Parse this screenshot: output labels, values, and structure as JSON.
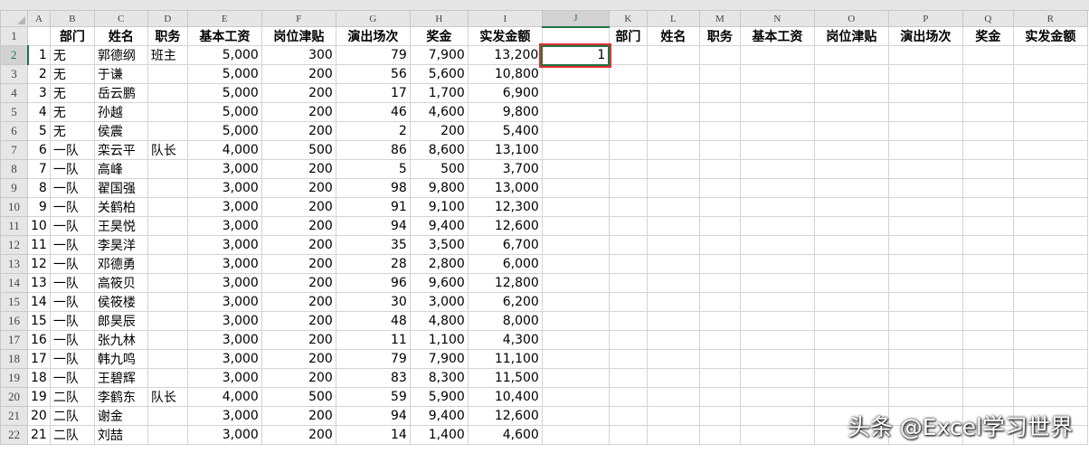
{
  "columns": [
    "A",
    "B",
    "C",
    "D",
    "E",
    "F",
    "G",
    "H",
    "I",
    "J",
    "K",
    "L",
    "M",
    "N",
    "O",
    "P",
    "Q",
    "R"
  ],
  "header_left": [
    "",
    "部门",
    "姓名",
    "职务",
    "基本工资",
    "岗位津贴",
    "演出场次",
    "奖金",
    "实发金额"
  ],
  "header_right": [
    "部门",
    "姓名",
    "职务",
    "基本工资",
    "岗位津贴",
    "演出场次",
    "奖金",
    "实发金额"
  ],
  "rows": [
    [
      "1",
      "无",
      "郭德纲",
      "班主",
      "5,000",
      "300",
      "79",
      "7,900",
      "13,200"
    ],
    [
      "2",
      "无",
      "于谦",
      "",
      "5,000",
      "200",
      "56",
      "5,600",
      "10,800"
    ],
    [
      "3",
      "无",
      "岳云鹏",
      "",
      "5,000",
      "200",
      "17",
      "1,700",
      "6,900"
    ],
    [
      "4",
      "无",
      "孙越",
      "",
      "5,000",
      "200",
      "46",
      "4,600",
      "9,800"
    ],
    [
      "5",
      "无",
      "侯震",
      "",
      "5,000",
      "200",
      "2",
      "200",
      "5,400"
    ],
    [
      "6",
      "一队",
      "栾云平",
      "队长",
      "4,000",
      "500",
      "86",
      "8,600",
      "13,100"
    ],
    [
      "7",
      "一队",
      "高峰",
      "",
      "3,000",
      "200",
      "5",
      "500",
      "3,700"
    ],
    [
      "8",
      "一队",
      "翟国强",
      "",
      "3,000",
      "200",
      "98",
      "9,800",
      "13,000"
    ],
    [
      "9",
      "一队",
      "关鹤柏",
      "",
      "3,000",
      "200",
      "91",
      "9,100",
      "12,300"
    ],
    [
      "10",
      "一队",
      "王昊悦",
      "",
      "3,000",
      "200",
      "94",
      "9,400",
      "12,600"
    ],
    [
      "11",
      "一队",
      "李昊洋",
      "",
      "3,000",
      "200",
      "35",
      "3,500",
      "6,700"
    ],
    [
      "12",
      "一队",
      "邓德勇",
      "",
      "3,000",
      "200",
      "28",
      "2,800",
      "6,000"
    ],
    [
      "13",
      "一队",
      "高筱贝",
      "",
      "3,000",
      "200",
      "96",
      "9,600",
      "12,800"
    ],
    [
      "14",
      "一队",
      "侯筱楼",
      "",
      "3,000",
      "200",
      "30",
      "3,000",
      "6,200"
    ],
    [
      "15",
      "一队",
      "郎昊辰",
      "",
      "3,000",
      "200",
      "48",
      "4,800",
      "8,000"
    ],
    [
      "16",
      "一队",
      "张九林",
      "",
      "3,000",
      "200",
      "11",
      "1,100",
      "4,300"
    ],
    [
      "17",
      "一队",
      "韩九鸣",
      "",
      "3,000",
      "200",
      "79",
      "7,900",
      "11,100"
    ],
    [
      "18",
      "一队",
      "王碧辉",
      "",
      "3,000",
      "200",
      "83",
      "8,300",
      "11,500"
    ],
    [
      "19",
      "二队",
      "李鹤东",
      "队长",
      "4,000",
      "500",
      "59",
      "5,900",
      "10,400"
    ],
    [
      "20",
      "二队",
      "谢金",
      "",
      "3,000",
      "200",
      "94",
      "9,400",
      "12,600"
    ],
    [
      "21",
      "二队",
      "刘喆",
      "",
      "3,000",
      "200",
      "14",
      "1,400",
      "4,600"
    ]
  ],
  "active_cell": {
    "ref": "J2",
    "value": "1"
  },
  "watermark": "头条 @Excel学习世界"
}
